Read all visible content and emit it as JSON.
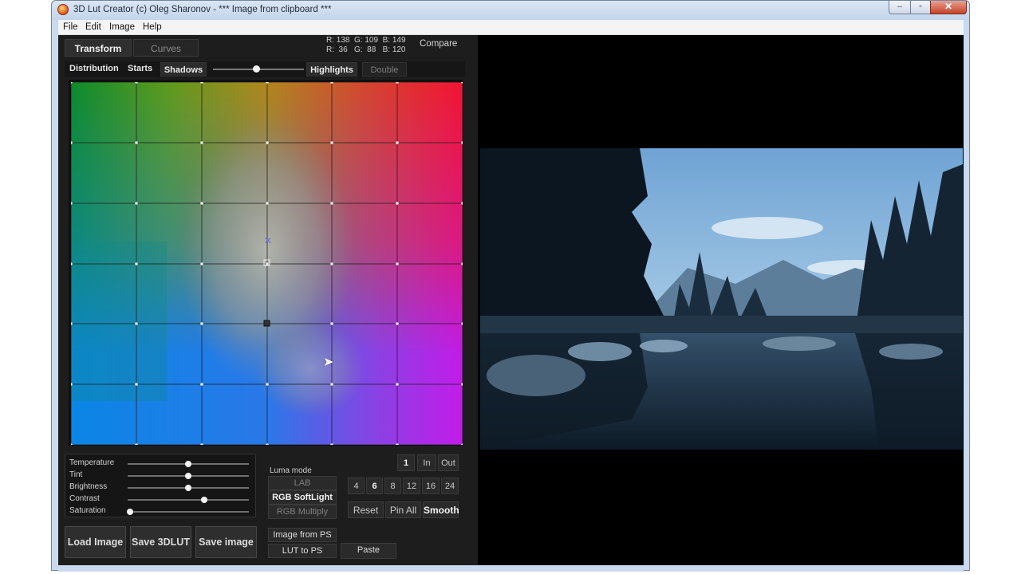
{
  "window": {
    "title": "3D Lut Creator (c) Oleg Sharonov -  *** Image from clipboard ***",
    "controls": {
      "minimize": "–",
      "maximize": "▫",
      "close": "✕"
    }
  },
  "menu": [
    "File",
    "Edit",
    "Image",
    "Help"
  ],
  "tabs": {
    "transform": "Transform",
    "curves": "Curves"
  },
  "readout": {
    "line1": "R: 138  G: 109  B: 149",
    "line2": "R:  36   G:  88   B: 120"
  },
  "compare": "Compare",
  "subbar": {
    "distribution": "Distribution",
    "starts": "Starts",
    "shadows": "Shadows",
    "shadow_slider": 0.5,
    "highlights": "Highlights",
    "double": "Double"
  },
  "sliders": [
    {
      "label": "Temperature",
      "value": 0.5
    },
    {
      "label": "Tint",
      "value": 0.5
    },
    {
      "label": "Brightness",
      "value": 0.5
    },
    {
      "label": "Contrast",
      "value": 0.63
    },
    {
      "label": "Saturation",
      "value": 0.02
    }
  ],
  "luma": {
    "label": "Luma mode",
    "options": [
      "LAB",
      "RGB SoftLight",
      "RGB Multiply"
    ],
    "selected": "RGB SoftLight"
  },
  "io_buttons": [
    "1",
    "In",
    "Out"
  ],
  "grid_sizes": {
    "options": [
      "4",
      "6",
      "8",
      "12",
      "16",
      "24"
    ],
    "selected": "6"
  },
  "actions": {
    "reset": "Reset",
    "pin_all": "Pin All",
    "smooth": "Smooth"
  },
  "ps": {
    "image_from_ps": "Image from PS",
    "lut_to_ps": "LUT to PS",
    "paste": "Paste"
  },
  "bottom_buttons": {
    "load": "Load Image",
    "save3dlut": "Save 3DLUT",
    "save_image": "Save image"
  }
}
